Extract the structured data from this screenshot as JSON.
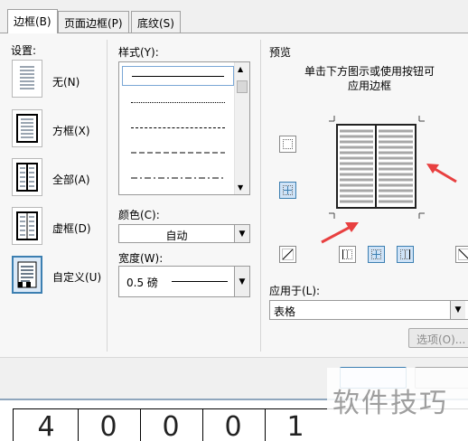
{
  "tabs": [
    {
      "label": "边框(B)",
      "active": true
    },
    {
      "label": "页面边框(P)",
      "active": false
    },
    {
      "label": "底纹(S)",
      "active": false
    }
  ],
  "settings": {
    "heading": "设置:",
    "items": [
      {
        "label": "无(N)",
        "icon": "border-none-icon",
        "selected": false
      },
      {
        "label": "方框(X)",
        "icon": "border-box-icon",
        "selected": false
      },
      {
        "label": "全部(A)",
        "icon": "border-all-icon",
        "selected": false
      },
      {
        "label": "虚框(D)",
        "icon": "border-grid-icon",
        "selected": false
      },
      {
        "label": "自定义(U)",
        "icon": "border-custom-icon",
        "selected": true
      }
    ]
  },
  "style": {
    "heading": "样式(Y):",
    "line_styles": [
      "solid",
      "dotted",
      "dashed-small",
      "dashed",
      "dash-dot",
      "dash-dot-dot"
    ],
    "selected_index": 0
  },
  "color": {
    "label": "颜色(C):",
    "value": "自动"
  },
  "width": {
    "label": "宽度(W):",
    "value": "0.5 磅"
  },
  "preview": {
    "heading": "预览",
    "hint_line1": "单击下方图示或使用按钮可",
    "hint_line2": "应用边框"
  },
  "apply_to": {
    "label": "应用于(L):",
    "value": "表格"
  },
  "options_button": "选项(O)...",
  "watermark": "软件技巧",
  "background_numbers": [
    "4",
    "0",
    "0",
    "0",
    "1"
  ],
  "colors": {
    "accent": "#3c7fb1",
    "arrow_red": "#e84040"
  }
}
